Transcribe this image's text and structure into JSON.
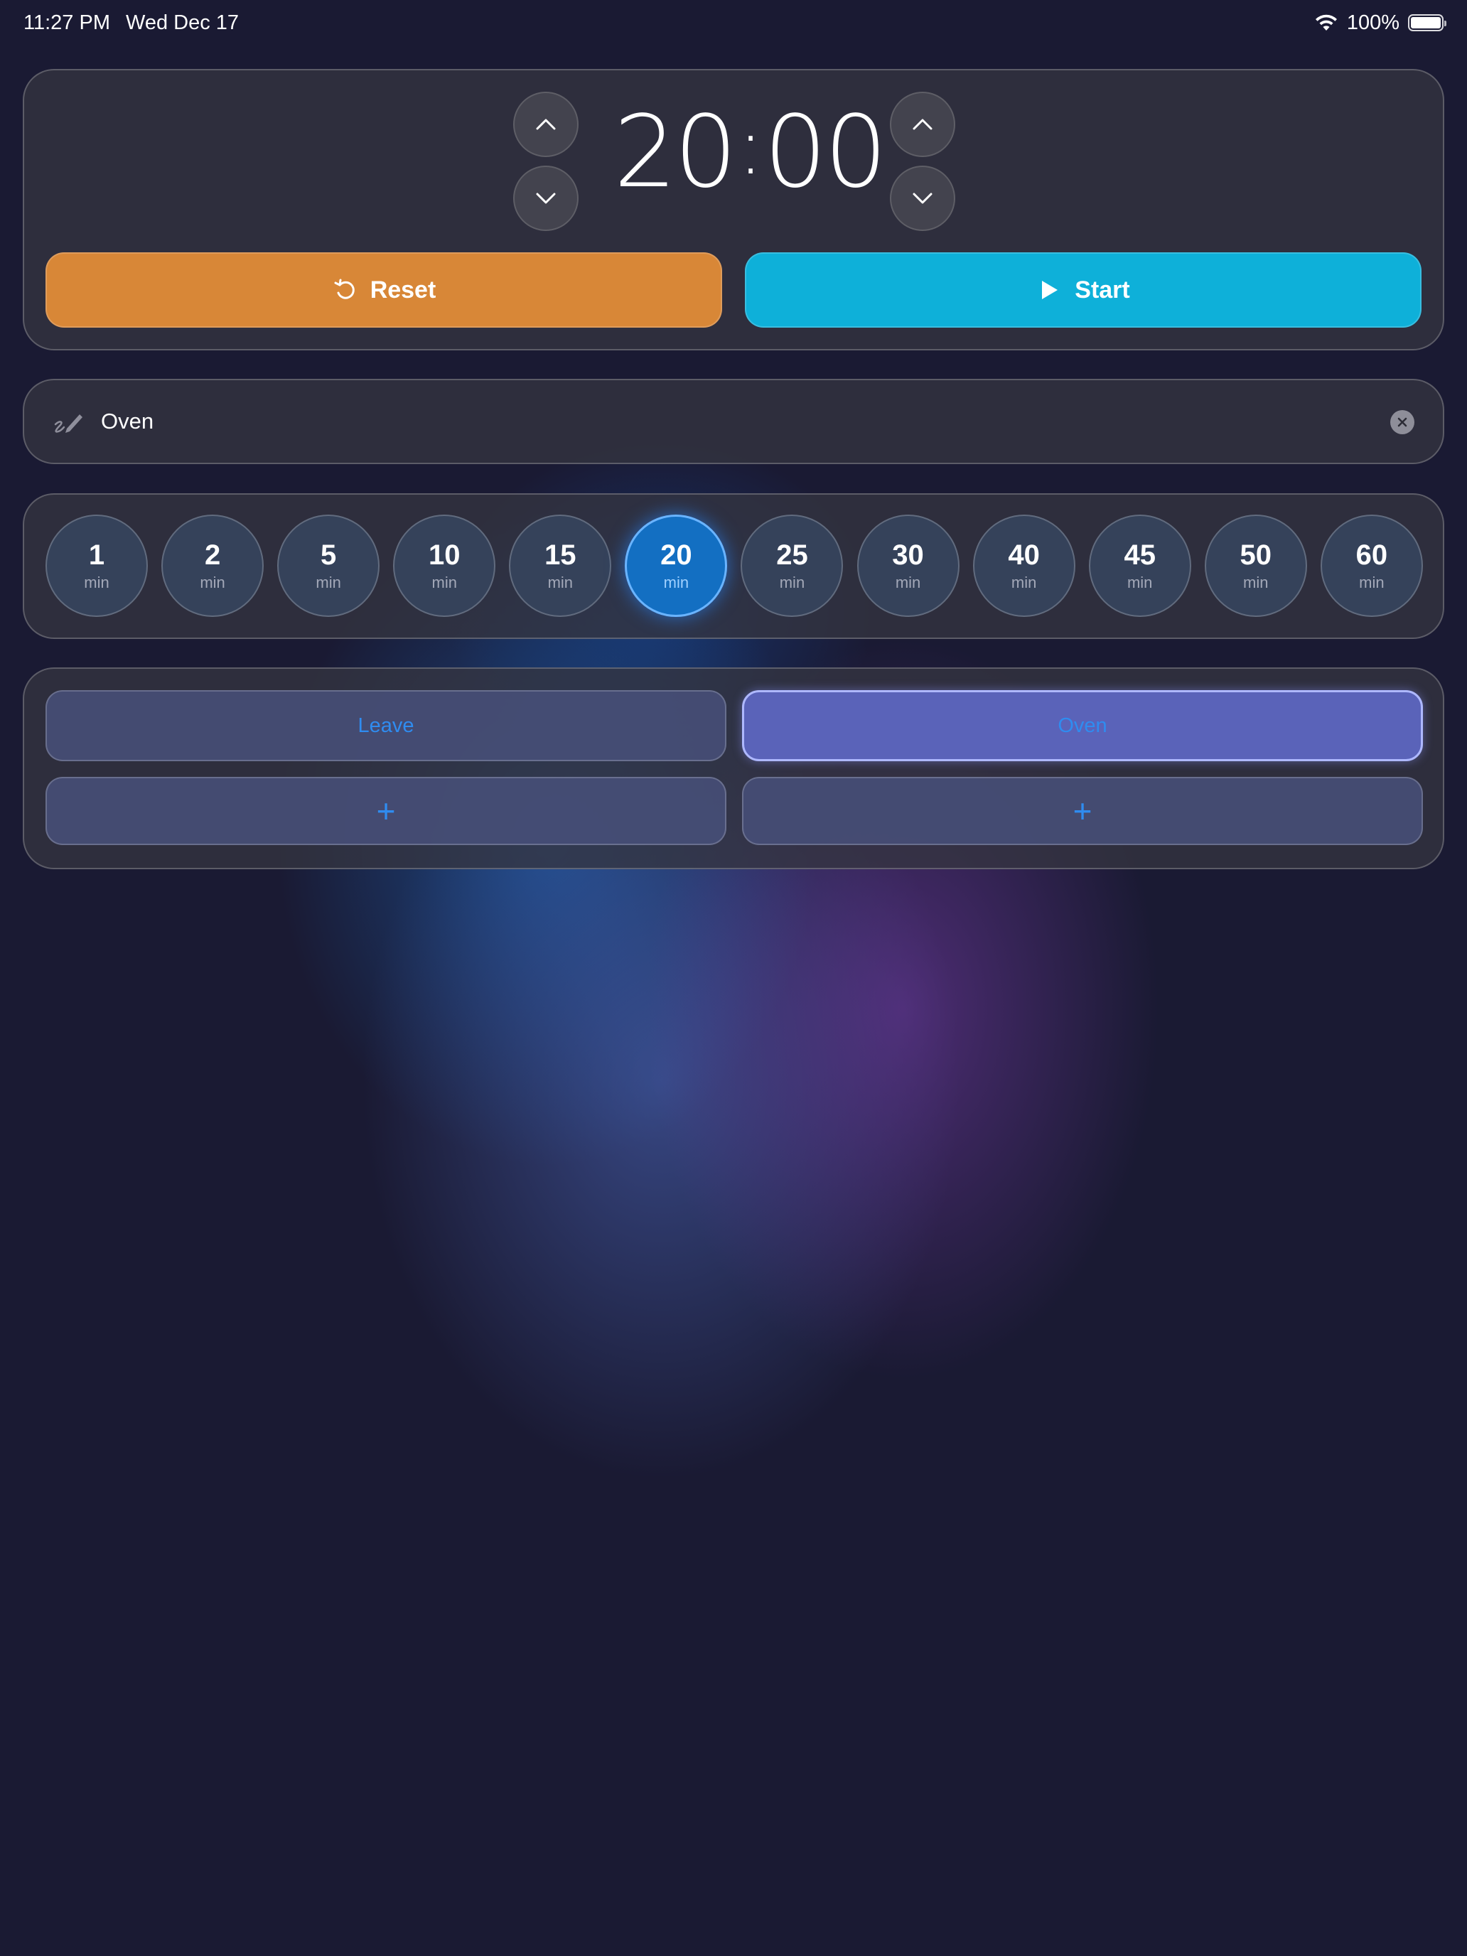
{
  "status_bar": {
    "time": "11:27 PM",
    "date": "Wed Dec 17",
    "battery": "100%",
    "battery_level": 1.0
  },
  "timer": {
    "minutes": "20",
    "separator": ":",
    "seconds": "00",
    "reset_label": "Reset",
    "start_label": "Start"
  },
  "label_field": {
    "value": "Oven"
  },
  "presets": [
    {
      "value": "1",
      "unit": "min"
    },
    {
      "value": "2",
      "unit": "min"
    },
    {
      "value": "5",
      "unit": "min"
    },
    {
      "value": "10",
      "unit": "min"
    },
    {
      "value": "15",
      "unit": "min"
    },
    {
      "value": "20",
      "unit": "min"
    },
    {
      "value": "25",
      "unit": "min"
    },
    {
      "value": "30",
      "unit": "min"
    },
    {
      "value": "40",
      "unit": "min"
    },
    {
      "value": "45",
      "unit": "min"
    },
    {
      "value": "50",
      "unit": "min"
    },
    {
      "value": "60",
      "unit": "min"
    }
  ],
  "selected_preset": "20",
  "saved_timers": [
    {
      "label": "Leave",
      "active": false
    },
    {
      "label": "Oven",
      "active": true
    },
    {
      "label": "+",
      "active": false
    },
    {
      "label": "+",
      "active": false
    }
  ],
  "colors": {
    "reset": "#d88737",
    "start": "#0eb0d9",
    "selected_preset": "#136fc2",
    "active_saved": "#5a63b9",
    "saved_text": "#2f8cf0"
  },
  "icons": {
    "reset": "counterclockwise-arrow-icon",
    "start": "play-icon",
    "label": "pencil-scribble-icon",
    "clear": "clear-circle-icon",
    "up": "chevron-up-icon",
    "down": "chevron-down-icon"
  }
}
